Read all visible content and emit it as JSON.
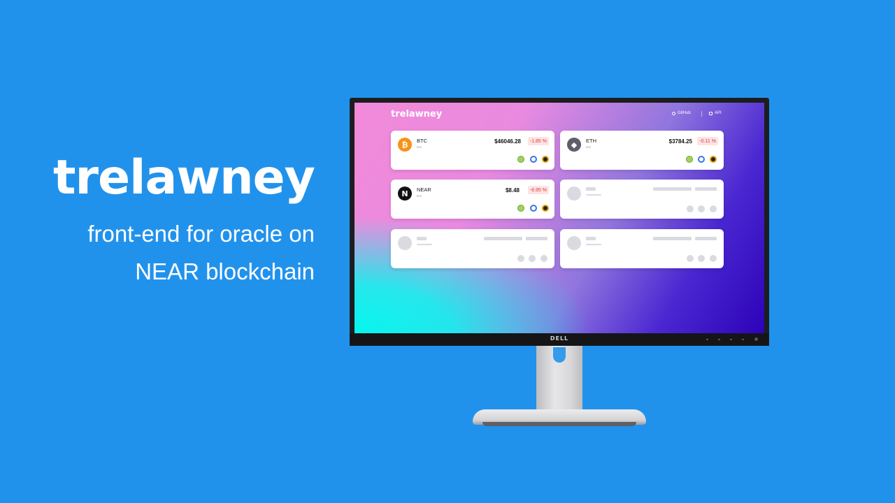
{
  "headline": {
    "title": "trelawney",
    "subtitle_line1": "front-end for oracle on",
    "subtitle_line2": "NEAR blockchain"
  },
  "monitor": {
    "brand": "DELL"
  },
  "app": {
    "logo": "trelawney",
    "nav": {
      "github": "GitHub",
      "api": "API"
    },
    "cards": [
      {
        "symbol": "BTC",
        "currency": "Dai",
        "price": "$46046.28",
        "change": "-1.85 %",
        "icon": "bitcoin-icon",
        "icon_glyph": "₿",
        "icon_color": "#f7931a"
      },
      {
        "symbol": "ETH",
        "currency": "Dai",
        "price": "$3784.25",
        "change": "-0.11 %",
        "icon": "ethereum-icon",
        "icon_glyph": "◆",
        "icon_color": "#5f5f6b"
      },
      {
        "symbol": "NEAR",
        "currency": "Dai",
        "price": "$8.48",
        "change": "-6.95 %",
        "icon": "near-icon",
        "icon_glyph": "N",
        "icon_color": "#111111"
      }
    ],
    "colors": {
      "negative": "#e03b3b",
      "negative_bg": "#fde3e3",
      "page_bg": "#2192ec"
    }
  }
}
